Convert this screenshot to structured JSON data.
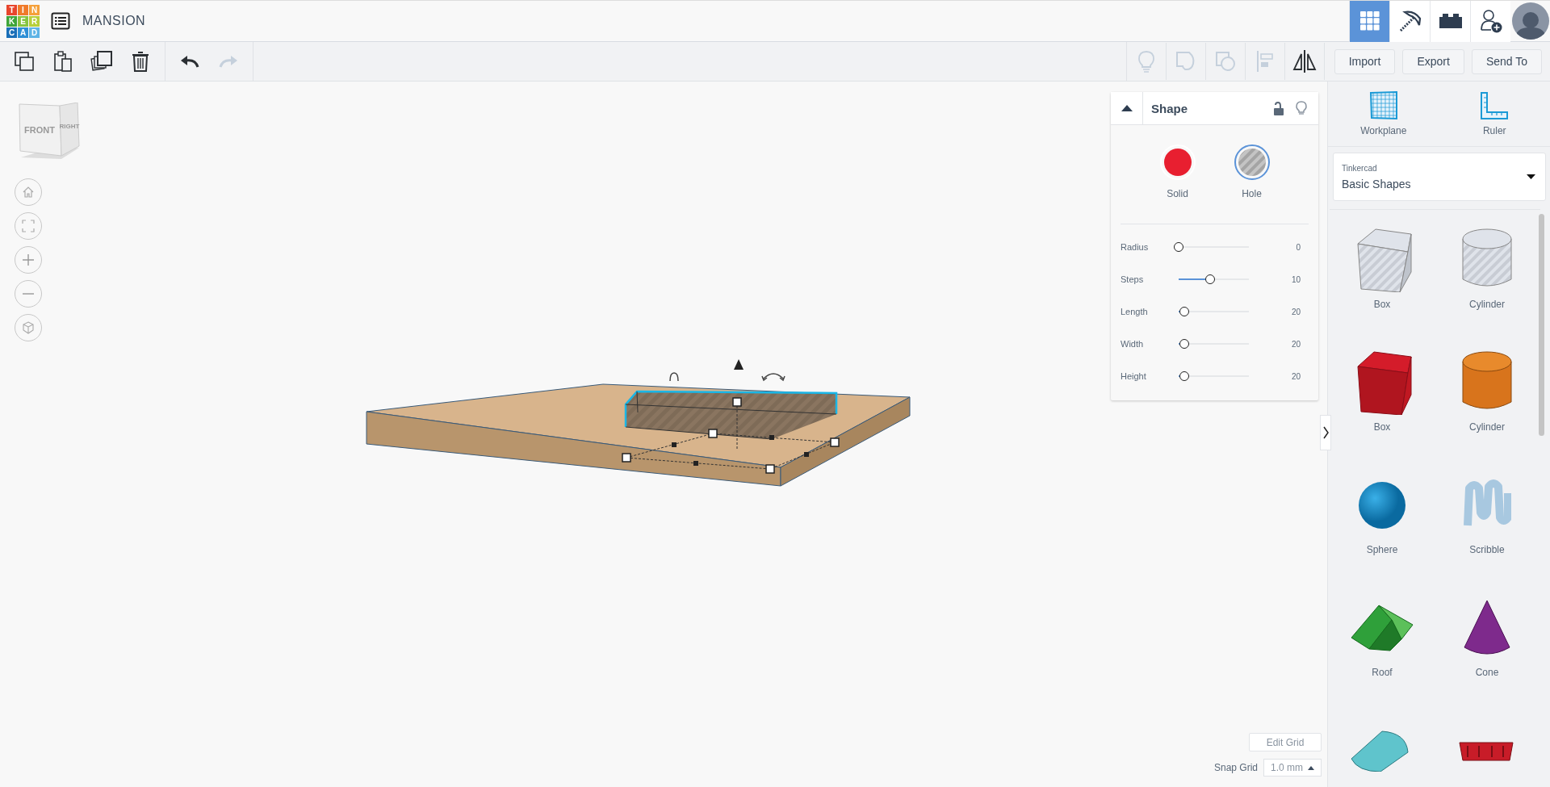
{
  "header": {
    "logo_letters": [
      "T",
      "I",
      "N",
      "K",
      "E",
      "R",
      "C",
      "A",
      "D"
    ],
    "project_title": "MANSION",
    "views": [
      {
        "kind": "grid",
        "selected": true
      },
      {
        "kind": "pickaxe",
        "selected": false
      },
      {
        "kind": "brick",
        "selected": false
      }
    ]
  },
  "edit_toolbar": [
    {
      "kind": "copy",
      "disabled": false
    },
    {
      "kind": "paste",
      "disabled": false
    },
    {
      "kind": "duplicate",
      "disabled": false
    },
    {
      "kind": "delete",
      "disabled": false
    },
    {
      "kind": "undo",
      "disabled": false
    },
    {
      "kind": "redo",
      "disabled": true
    }
  ],
  "shape_toolbar": [
    {
      "kind": "bulb",
      "disabled": true
    },
    {
      "kind": "group",
      "disabled": true
    },
    {
      "kind": "ungroup",
      "disabled": true
    },
    {
      "kind": "align",
      "disabled": true
    },
    {
      "kind": "mirror",
      "disabled": false
    }
  ],
  "actions": [
    "Import",
    "Export",
    "Send To"
  ],
  "view_cube": {
    "front": "FRONT",
    "right": "RIGHT"
  },
  "nav_controls": [
    {
      "kind": "home"
    },
    {
      "kind": "fit"
    },
    {
      "kind": "zoom-in"
    },
    {
      "kind": "zoom-out"
    },
    {
      "kind": "perspective"
    }
  ],
  "shape_panel": {
    "title": "Shape",
    "expanded": true,
    "types": [
      {
        "kind": "solid",
        "label": "Solid",
        "selected": false
      },
      {
        "kind": "hole",
        "label": "Hole",
        "selected": true
      }
    ],
    "params": [
      {
        "name": "Radius",
        "level": 0,
        "reading": "0"
      },
      {
        "name": "Steps",
        "level": 0.45,
        "reading": "10"
      },
      {
        "name": "Length",
        "level": 0.08,
        "reading": "20"
      },
      {
        "name": "Width",
        "level": 0.08,
        "reading": "20"
      },
      {
        "name": "Height",
        "level": 0.08,
        "reading": "20"
      }
    ]
  },
  "grid": {
    "edit": "Edit Grid",
    "snap_label": "Snap Grid",
    "snap_value": "1.0 mm"
  },
  "library": {
    "tools": [
      {
        "kind": "workplane",
        "label": "Workplane"
      },
      {
        "kind": "ruler",
        "label": "Ruler"
      }
    ],
    "provider": "Tinkercad",
    "category": "Basic Shapes",
    "shapes": [
      {
        "kind": "box-hole",
        "label": "Box"
      },
      {
        "kind": "cylinder-hole",
        "label": "Cylinder"
      },
      {
        "kind": "box",
        "label": "Box"
      },
      {
        "kind": "cylinder",
        "label": "Cylinder"
      },
      {
        "kind": "sphere",
        "label": "Sphere"
      },
      {
        "kind": "scribble",
        "label": "Scribble"
      },
      {
        "kind": "roof",
        "label": "Roof"
      },
      {
        "kind": "cone",
        "label": "Cone"
      },
      {
        "kind": "half-cylinder"
      },
      {
        "kind": "text-shape"
      }
    ]
  }
}
